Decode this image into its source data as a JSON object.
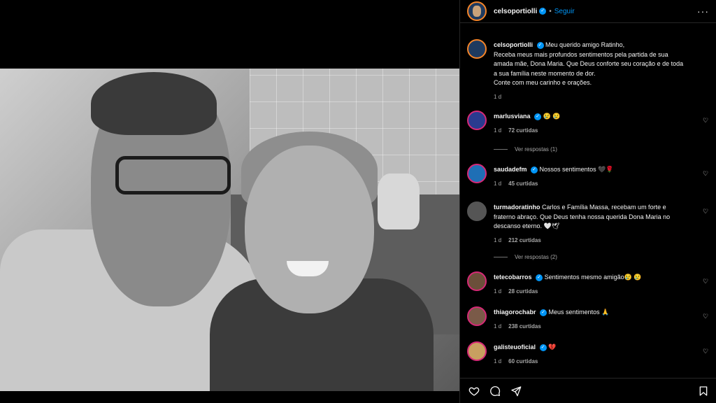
{
  "post": {
    "author": "celsoportiolli",
    "follow_label": "Seguir",
    "separator": "•",
    "caption_lines": [
      "Meu querido amigo Ratinho,",
      "Receba meus mais profundos sentimentos pela partida de sua",
      "amada mãe, Dona Maria. Que Deus conforte seu coração e de toda",
      "a sua família neste momento de dor.",
      "Conte com meu carinho e orações."
    ],
    "caption_time": "1 d"
  },
  "comments": [
    {
      "user": "marlusviana",
      "verified": true,
      "text": "😢 😢",
      "time": "1 d",
      "likes": "72 curtidas",
      "replies": "Ver respostas (1)"
    },
    {
      "user": "saudadefm",
      "verified": true,
      "text": "Nossos sentimentos 🖤🌹",
      "time": "1 d",
      "likes": "45 curtidas"
    },
    {
      "user": "turmadoratinho",
      "verified": false,
      "text_lines": [
        "Carlos e Família Massa, recebam um forte e",
        "fraterno abraço. Que Deus tenha nossa querida Dona Maria no",
        "descanso eterno. 🤍🕊"
      ],
      "time": "1 d",
      "likes": "212 curtidas",
      "replies": "Ver respostas (2)"
    },
    {
      "user": "tetecobarros",
      "verified": true,
      "text": "Sentimentos mesmo amigão😢 😢",
      "time": "1 d",
      "likes": "28 curtidas"
    },
    {
      "user": "thiagorochabr",
      "verified": true,
      "text": "Meus sentimentos 🙏",
      "time": "1 d",
      "likes": "238 curtidas"
    },
    {
      "user": "galisteuoficial",
      "verified": true,
      "text": "💔",
      "time": "1 d",
      "likes": "60 curtidas"
    }
  ],
  "verified_mark": "✓",
  "heart_glyph": "♡",
  "more_glyph": "···"
}
